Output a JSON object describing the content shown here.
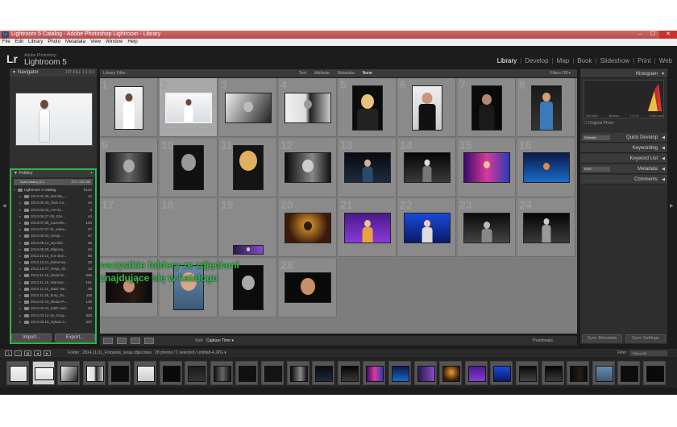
{
  "window": {
    "title": "Lightroom 5 Catalog - Adobe Photoshop Lightroom - Library",
    "controls": [
      "–",
      "☐",
      "✕"
    ]
  },
  "menu": [
    "File",
    "Edit",
    "Library",
    "Photo",
    "Metadata",
    "View",
    "Window",
    "Help"
  ],
  "identity": {
    "logo": "Lr",
    "small": "Adobe Photoshop",
    "name": "Lightroom 5"
  },
  "modules": [
    {
      "label": "Library",
      "active": true
    },
    {
      "label": "Develop",
      "active": false
    },
    {
      "label": "Map",
      "active": false
    },
    {
      "label": "Book",
      "active": false
    },
    {
      "label": "Slideshow",
      "active": false
    },
    {
      "label": "Print",
      "active": false
    },
    {
      "label": "Web",
      "active": false
    }
  ],
  "navigator": {
    "title": "Navigator",
    "options": "FIT FILL 1:1 3:1"
  },
  "folders": {
    "title": "Foldery",
    "volume": "Dysk lokalny (C:)",
    "volume_size": "371 / 931 GB",
    "catalog": {
      "label": "Lightroom 4 catalog",
      "count": "5122"
    },
    "items": [
      {
        "label": "2013.05.28_Monika_...",
        "count": "12"
      },
      {
        "label": "2013.05.30_Ślub Ca...",
        "count": "44"
      },
      {
        "label": "2013.06.02_rom-kj...",
        "count": "3"
      },
      {
        "label": "2013.06.27-28_Sze...",
        "count": "44"
      },
      {
        "label": "2013.07.06_Łazienki...",
        "count": "134"
      },
      {
        "label": "2013.07.07-31_waka...",
        "count": "27"
      },
      {
        "label": "2013.08.23_Sesja ...",
        "count": "47"
      },
      {
        "label": "2013.09.12_wycinki...",
        "count": "36"
      },
      {
        "label": "2013.09.29_Bilgoraj...",
        "count": "44"
      },
      {
        "label": "2013.10.14_Ilon Bon...",
        "count": "56"
      },
      {
        "label": "2013.10.21_Balcerow...",
        "count": "29"
      },
      {
        "label": "2013.10.27_sesja_ob...",
        "count": "13"
      },
      {
        "label": "2013.11.16_otwarcie...",
        "count": "249"
      },
      {
        "label": "2013.11.18_Warsaw ...",
        "count": "161"
      },
      {
        "label": "2013.11.21_D&D Har...",
        "count": "39"
      },
      {
        "label": "2013.11.28_bury_do...",
        "count": "116"
      },
      {
        "label": "2014.02.19_Beata Pr...",
        "count": "148"
      },
      {
        "label": "2014.02.24_D&D Harl...",
        "count": "33"
      },
      {
        "label": "2014.03.14-16_Gorg...",
        "count": "320"
      },
      {
        "label": "2014.03.18_Sylwia a...",
        "count": "237"
      }
    ],
    "last_count": "71"
  },
  "left_buttons": {
    "import": "Import...",
    "export": "Export..."
  },
  "filter_bar": {
    "label": "Library Filter :",
    "options": [
      {
        "label": "Text",
        "on": false
      },
      {
        "label": "Attribute",
        "on": false
      },
      {
        "label": "Metadata",
        "on": false
      },
      {
        "label": "None",
        "on": true
      }
    ],
    "filters_off": "Filters Off ▾"
  },
  "overlay": {
    "line1": "wszystkie foldery ze zdjęciami",
    "line2": "znajdujące się w katalogu"
  },
  "grid": {
    "columns": 8,
    "cells": [
      {
        "n": "1",
        "sel": false,
        "img": "bride-white"
      },
      {
        "n": "2",
        "sel": true,
        "img": "bride-landscape"
      },
      {
        "n": "3",
        "sel": false,
        "img": "bw-lying"
      },
      {
        "n": "4",
        "sel": false,
        "img": "bw-couple"
      },
      {
        "n": "5",
        "sel": false,
        "img": "blonde-dark"
      },
      {
        "n": "6",
        "sel": false,
        "img": "man-suit"
      },
      {
        "n": "7",
        "sel": false,
        "img": "man-dark"
      },
      {
        "n": "8",
        "sel": false,
        "img": "color-group"
      },
      {
        "n": "9",
        "sel": false,
        "img": "bw-face-land"
      },
      {
        "n": "10",
        "sel": false,
        "img": "bw-curly"
      },
      {
        "n": "11",
        "sel": false,
        "img": "blonde-curly"
      },
      {
        "n": "12",
        "sel": false,
        "img": "bw-woman-land"
      },
      {
        "n": "13",
        "sel": false,
        "img": "stage-duo"
      },
      {
        "n": "14",
        "sel": false,
        "img": "stage-band"
      },
      {
        "n": "15",
        "sel": false,
        "img": "stage-pink"
      },
      {
        "n": "16",
        "sel": false,
        "img": "stage-blue"
      },
      {
        "n": "17",
        "sel": false,
        "img": "empty"
      },
      {
        "n": "18",
        "sel": false,
        "img": "empty"
      },
      {
        "n": "19",
        "sel": false,
        "img": "partial"
      },
      {
        "n": "20",
        "sel": false,
        "img": "concert-orange"
      },
      {
        "n": "21",
        "sel": false,
        "img": "guitar-purple"
      },
      {
        "n": "22",
        "sel": false,
        "img": "drums-blue"
      },
      {
        "n": "23",
        "sel": false,
        "img": "drummer-dark"
      },
      {
        "n": "24",
        "sel": false,
        "img": "drums-bw"
      },
      {
        "n": "25",
        "sel": false,
        "img": "woman-dark"
      },
      {
        "n": "26",
        "sel": false,
        "img": "woman-blue"
      },
      {
        "n": "27",
        "sel": false,
        "img": "bw-long-hair"
      },
      {
        "n": "28",
        "sel": false,
        "img": "woman-closeup"
      }
    ]
  },
  "toolbar": {
    "sort_label": "Sort:",
    "sort_value": "Capture Time ▾",
    "thumbnails": "Thumbnails"
  },
  "right_panel": {
    "histogram": "Histogram",
    "hist_values": [
      "ISO 800",
      "85 mm",
      "f / 2.8",
      "1/320 sec"
    ],
    "original_photo": "Original Photo",
    "quick_develop": "Quick Develop",
    "quick_preset": "Defaults",
    "keywording": "Keywording",
    "keyword_list": "Keyword List",
    "metadata": "Metadata",
    "metadata_preset": "EXIF",
    "comments": "Comments",
    "sync_metadata": "Sync Metadata",
    "sync_settings": "Sync Settings"
  },
  "filmstrip_bar": {
    "pages": [
      "1",
      "2"
    ],
    "path": "Folder : 2014.11.01_Fotopolis_sesja zdjeciowa",
    "count": "28 photos / 1 selected / untitled-4.JPG ▾",
    "filter_label": "Filter :",
    "filter_value": "Filters Off"
  },
  "filmstrip": [
    "bride-white",
    "bride-landscape",
    "bw-lying",
    "bw-couple",
    "blonde-dark",
    "man-suit",
    "man-dark",
    "color-group",
    "bw-face-land",
    "bw-curly",
    "blonde-curly",
    "bw-woman-land",
    "stage-duo",
    "stage-band",
    "stage-pink",
    "stage-blue",
    "partial",
    "concert-orange",
    "guitar-purple",
    "drums-blue",
    "drummer-dark",
    "drums-bw",
    "woman-dark",
    "woman-blue",
    "bw-long-hair",
    "woman-closeup"
  ]
}
